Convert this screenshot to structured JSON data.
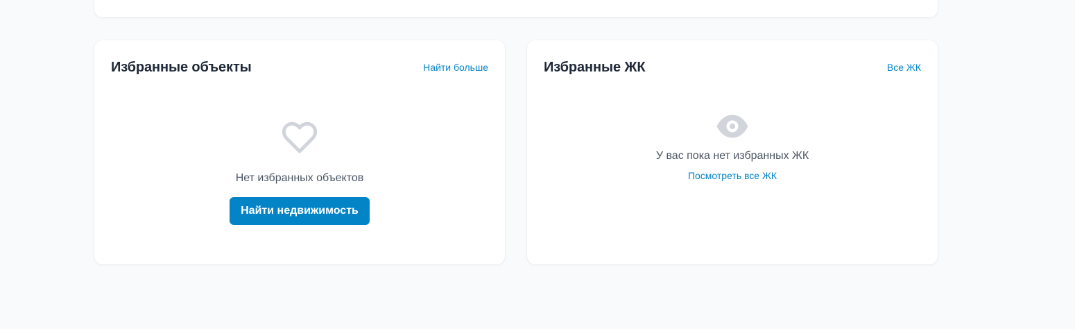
{
  "favorites_card": {
    "title": "Избранные объекты",
    "header_link": "Найти больше",
    "empty_icon": "heart-icon",
    "empty_text": "Нет избранных объектов",
    "cta_button": "Найти недвижимость"
  },
  "complexes_card": {
    "title": "Избранные ЖК",
    "header_link": "Все ЖК",
    "empty_icon": "eye-icon",
    "empty_text": "У вас пока нет избранных ЖК",
    "empty_link": "Посмотреть все ЖК"
  },
  "colors": {
    "accent": "#0284c7",
    "background": "#f9fafb",
    "card": "#ffffff",
    "icon_muted": "#d1d5db",
    "title_text": "#1f2937",
    "body_text": "#4b5563"
  }
}
